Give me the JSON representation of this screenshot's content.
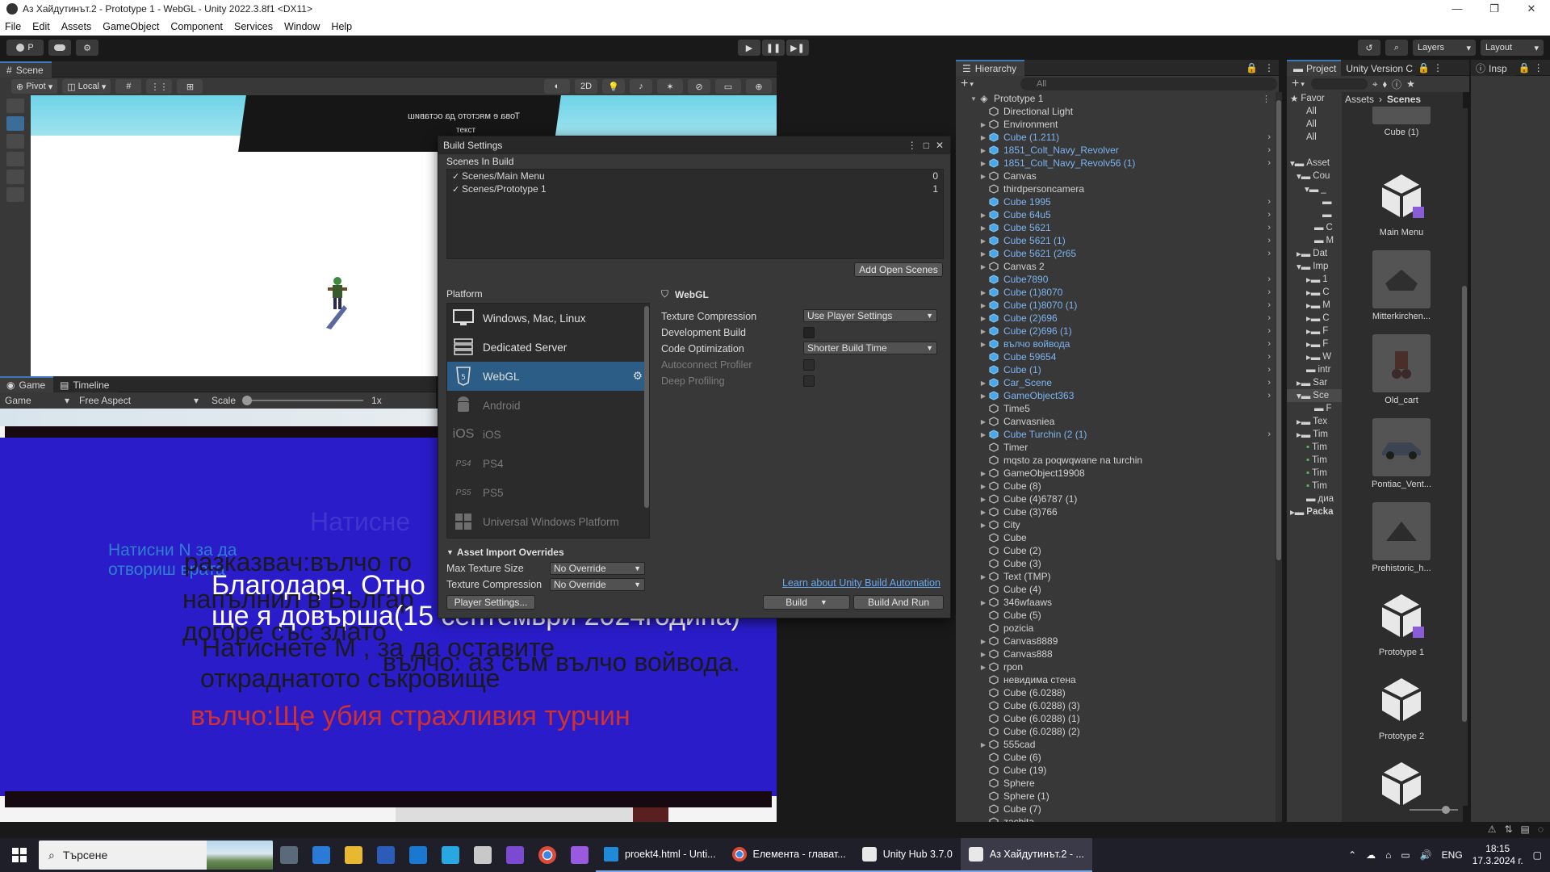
{
  "window": {
    "title": "Аз Хайдутинът.2 - Prototype 1 - WebGL - Unity 2022.3.8f1 <DX11>",
    "controls": [
      "—",
      "❐",
      "✕"
    ]
  },
  "menu": [
    "File",
    "Edit",
    "Assets",
    "GameObject",
    "Component",
    "Services",
    "Window",
    "Help"
  ],
  "toolbar": {
    "account_label": "P",
    "layers_label": "Layers",
    "layout_label": "Layout"
  },
  "scene": {
    "tab": "Scene",
    "pivot": "Pivot",
    "local": "Local",
    "mode_2d": "2D",
    "board_text": "Това е мястото да оставиш",
    "board_sub": "текст"
  },
  "game": {
    "tab_game": "Game",
    "tab_timeline": "Timeline",
    "display": "Game",
    "aspect": "Free Aspect",
    "scale_label": "Scale",
    "scale_value": "1x",
    "texts": {
      "natisnete_faint": "Натисне",
      "natisni_n": "Натисни N за да",
      "otvorish": "отвориш врата",
      "razkazvach": "разказвач:вълчо го",
      "blagodarya": "Благодаря. Отно",
      "napalnil": "напълнил в Българ",
      "dovarsha": "ще я довърша(15 септември 2024година)",
      "dogore": "догоре със злато",
      "natisnete_m": "Натиснете М , за да оставите",
      "valcho_az": "вълчо: аз съм вълчо войвода.",
      "otkradnatoto": "откраднатото съкровище",
      "valcho_shte": "вълчо:Ще убия страхливия турчин"
    }
  },
  "build": {
    "title": "Build Settings",
    "scenes_header": "Scenes In Build",
    "scenes": [
      {
        "name": "Scenes/Main Menu",
        "index": "0"
      },
      {
        "name": "Scenes/Prototype 1",
        "index": "1"
      }
    ],
    "add_open_scenes": "Add Open Scenes",
    "platform_header": "Platform",
    "platforms": [
      {
        "label": "Windows, Mac, Linux",
        "icon": "monitor-icon"
      },
      {
        "label": "Dedicated Server",
        "icon": "server-icon"
      },
      {
        "label": "WebGL",
        "icon": "html5-icon"
      },
      {
        "label": "Android",
        "icon": "android-icon"
      },
      {
        "label": "iOS",
        "icon": "ios-icon"
      },
      {
        "label": "PS4",
        "icon": "ps4-icon"
      },
      {
        "label": "PS5",
        "icon": "ps5-icon"
      },
      {
        "label": "Universal Windows Platform",
        "icon": "windows-icon"
      }
    ],
    "selected_platform": "WebGL",
    "settings_header": "WebGL",
    "texture_compression_label": "Texture Compression",
    "texture_compression_value": "Use Player Settings",
    "development_build_label": "Development Build",
    "code_optimization_label": "Code Optimization",
    "code_optimization_value": "Shorter Build Time",
    "autoconnect_profiler_label": "Autoconnect Profiler",
    "deep_profiling_label": "Deep Profiling",
    "asset_import_header": "Asset Import Overrides",
    "max_texture_label": "Max Texture Size",
    "max_texture_value": "No Override",
    "texture_compression2_label": "Texture Compression",
    "texture_compression2_value": "No Override",
    "learn_link": "Learn about Unity Build Automation",
    "player_settings": "Player Settings...",
    "build": "Build",
    "build_and_run": "Build And Run"
  },
  "hierarchy": {
    "tab": "Hierarchy",
    "search_placeholder": "All",
    "scene_name": "Prototype 1",
    "items": [
      {
        "name": "Directional Light",
        "prefab": false,
        "arrow": false,
        "more": false
      },
      {
        "name": "Environment",
        "prefab": false,
        "arrow": true,
        "more": false
      },
      {
        "name": "Cube (1.211)",
        "prefab": true,
        "arrow": true,
        "more": true
      },
      {
        "name": "1851_Colt_Navy_Revolver",
        "prefab": true,
        "arrow": true,
        "more": true
      },
      {
        "name": "1851_Colt_Navy_Revolv56 (1)",
        "prefab": true,
        "arrow": true,
        "more": true
      },
      {
        "name": "Canvas",
        "prefab": false,
        "arrow": true,
        "more": false
      },
      {
        "name": "thirdpersoncamera",
        "prefab": false,
        "arrow": false,
        "more": false
      },
      {
        "name": "Cube 1995",
        "prefab": true,
        "arrow": false,
        "more": true
      },
      {
        "name": "Cube 64u5",
        "prefab": true,
        "arrow": true,
        "more": true
      },
      {
        "name": "Cube 5621",
        "prefab": true,
        "arrow": true,
        "more": true
      },
      {
        "name": "Cube 5621 (1)",
        "prefab": true,
        "arrow": true,
        "more": true
      },
      {
        "name": "Cube 5621 (2r65",
        "prefab": true,
        "arrow": true,
        "more": true
      },
      {
        "name": "Canvas 2",
        "prefab": false,
        "arrow": true,
        "more": false
      },
      {
        "name": "Cube7890",
        "prefab": true,
        "arrow": false,
        "more": true
      },
      {
        "name": "Cube (1)8070",
        "prefab": true,
        "arrow": true,
        "more": true
      },
      {
        "name": "Cube (1)8070 (1)",
        "prefab": true,
        "arrow": true,
        "more": true
      },
      {
        "name": "Cube (2)696",
        "prefab": true,
        "arrow": true,
        "more": true
      },
      {
        "name": "Cube (2)696 (1)",
        "prefab": true,
        "arrow": true,
        "more": true
      },
      {
        "name": "вълчо войвода",
        "prefab": true,
        "arrow": true,
        "more": true
      },
      {
        "name": "Cube 59654",
        "prefab": true,
        "arrow": false,
        "more": true
      },
      {
        "name": "Cube (1)",
        "prefab": true,
        "arrow": false,
        "more": true
      },
      {
        "name": "Car_Scene",
        "prefab": true,
        "arrow": true,
        "more": true
      },
      {
        "name": "GameObject363",
        "prefab": true,
        "arrow": true,
        "more": true
      },
      {
        "name": "Time5",
        "prefab": false,
        "arrow": false,
        "more": false
      },
      {
        "name": "Canvasniea",
        "prefab": false,
        "arrow": true,
        "more": false
      },
      {
        "name": "Cube Turchin (2 (1)",
        "prefab": true,
        "arrow": true,
        "more": true
      },
      {
        "name": "Timer",
        "prefab": false,
        "arrow": false,
        "more": false
      },
      {
        "name": "mqsto za poqwqwane na turchin",
        "prefab": false,
        "arrow": false,
        "more": false
      },
      {
        "name": "GameObject19908",
        "prefab": false,
        "arrow": true,
        "more": false
      },
      {
        "name": "Cube (8)",
        "prefab": false,
        "arrow": true,
        "more": false
      },
      {
        "name": "Cube (4)6787 (1)",
        "prefab": false,
        "arrow": true,
        "more": false
      },
      {
        "name": "Cube (3)766",
        "prefab": false,
        "arrow": true,
        "more": false
      },
      {
        "name": "City",
        "prefab": false,
        "arrow": true,
        "more": false
      },
      {
        "name": "Cube",
        "prefab": false,
        "arrow": false,
        "more": false
      },
      {
        "name": "Cube (2)",
        "prefab": false,
        "arrow": false,
        "more": false
      },
      {
        "name": "Cube (3)",
        "prefab": false,
        "arrow": false,
        "more": false
      },
      {
        "name": "Text (TMP)",
        "prefab": false,
        "arrow": true,
        "more": false
      },
      {
        "name": "Cube (4)",
        "prefab": false,
        "arrow": false,
        "more": false
      },
      {
        "name": "346wfaaws",
        "prefab": false,
        "arrow": true,
        "more": false
      },
      {
        "name": "Cube (5)",
        "prefab": false,
        "arrow": false,
        "more": false
      },
      {
        "name": "pozicia",
        "prefab": false,
        "arrow": false,
        "more": false
      },
      {
        "name": "Canvas8889",
        "prefab": false,
        "arrow": true,
        "more": false
      },
      {
        "name": "Canvas888",
        "prefab": false,
        "arrow": true,
        "more": false
      },
      {
        "name": "rpon",
        "prefab": false,
        "arrow": true,
        "more": false
      },
      {
        "name": "невидима стена",
        "prefab": false,
        "arrow": false,
        "more": false
      },
      {
        "name": "Cube (6.0288)",
        "prefab": false,
        "arrow": false,
        "more": false
      },
      {
        "name": "Cube (6.0288) (3)",
        "prefab": false,
        "arrow": false,
        "more": false
      },
      {
        "name": "Cube (6.0288) (1)",
        "prefab": false,
        "arrow": false,
        "more": false
      },
      {
        "name": "Cube (6.0288) (2)",
        "prefab": false,
        "arrow": false,
        "more": false
      },
      {
        "name": "555cad",
        "prefab": false,
        "arrow": true,
        "more": false
      },
      {
        "name": "Cube (6)",
        "prefab": false,
        "arrow": false,
        "more": false
      },
      {
        "name": "Cube (19)",
        "prefab": false,
        "arrow": false,
        "more": false
      },
      {
        "name": "Sphere",
        "prefab": false,
        "arrow": false,
        "more": false
      },
      {
        "name": "Sphere (1)",
        "prefab": false,
        "arrow": false,
        "more": false
      },
      {
        "name": "Cube (7)",
        "prefab": false,
        "arrow": false,
        "more": false
      },
      {
        "name": "zachita",
        "prefab": false,
        "arrow": false,
        "more": false
      }
    ]
  },
  "project": {
    "tab": "Project",
    "version_tab": "Unity Version C",
    "inspector_tab": "Insp",
    "crumb_root": "Assets",
    "crumb_folder": "Scenes",
    "tree": [
      "Favor",
      "All",
      "All",
      "All",
      "",
      "Asset",
      "Cou",
      "_",
      "",
      "",
      "C",
      "M",
      "Dat",
      "Imp",
      "1",
      "C",
      "M",
      "C",
      "F",
      "F",
      "W",
      "intr",
      "Sar",
      "Sce",
      "F",
      "Tex",
      "Tim",
      "Tim",
      "Tim",
      "Tim",
      "Tim",
      "диа",
      "Packa"
    ],
    "assets": [
      {
        "name": "Cube (1)",
        "kind": "prefab"
      },
      {
        "name": "Main Menu",
        "kind": "scene"
      },
      {
        "name": "Mitterkirchen...",
        "kind": "image"
      },
      {
        "name": "Old_cart",
        "kind": "image"
      },
      {
        "name": "Pontiac_Vent...",
        "kind": "image"
      },
      {
        "name": "Prehistoric_h...",
        "kind": "image"
      },
      {
        "name": "Prototype 1",
        "kind": "scene"
      },
      {
        "name": "Prototype 2",
        "kind": "scene"
      },
      {
        "name": "",
        "kind": "scene"
      }
    ]
  },
  "taskbar": {
    "search_placeholder": "Търсене",
    "apps": [
      {
        "label": "proekt4.html - Unti...",
        "icon": "vscode-icon",
        "active": false
      },
      {
        "label": "Елемента - глават...",
        "icon": "chrome-icon",
        "active": false
      },
      {
        "label": "Unity Hub 3.7.0",
        "icon": "unity-hub-icon",
        "active": false
      },
      {
        "label": "Аз Хайдутинът.2 - ...",
        "icon": "unity-icon",
        "active": true
      }
    ],
    "lang": "ENG",
    "time": "18:15",
    "date": "17.3.2024 г."
  }
}
